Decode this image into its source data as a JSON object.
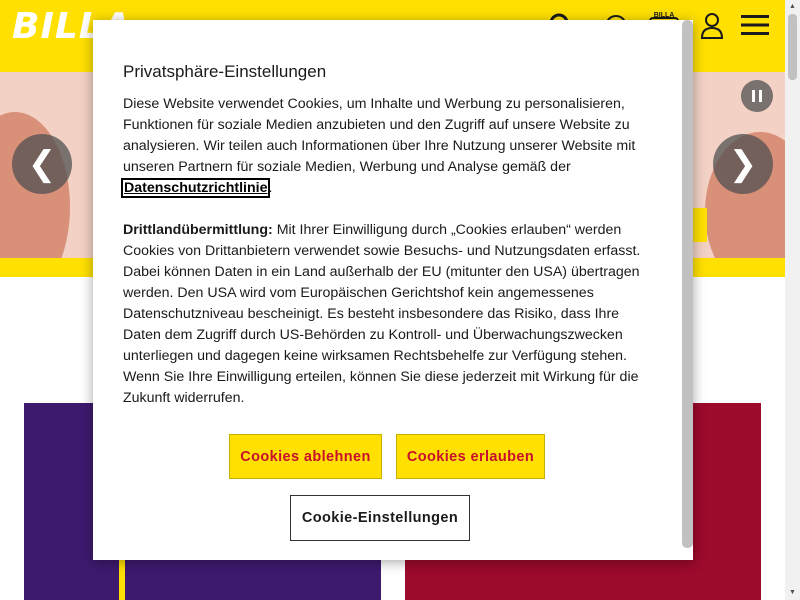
{
  "header": {
    "logo": "BILLA",
    "club_badge": "BILLA"
  },
  "hero": {
    "prev_symbol": "❮",
    "next_symbol": "❯"
  },
  "cookie_dialog": {
    "title": "Privatsphäre-Einstellungen",
    "intro_text": "Diese Website verwendet Cookies, um Inhalte und Werbung zu personalisieren, Funktionen für soziale Medien anzubieten und den Zugriff auf unsere Website zu analysieren. Wir teilen auch Informationen über Ihre Nutzung unserer Website mit unseren Partnern für soziale Medien, Werbung und Analyse gemäß der",
    "policy_link": "Datenschutzrichtlinie",
    "intro_end": ".",
    "third_country_label": "Drittlandübermittlung:",
    "third_country_text": " Mit Ihrer Einwilligung durch „Cookies erlauben“ werden Cookies von Drittanbietern verwendet sowie Besuchs- und Nutzungsdaten erfasst. Dabei können Daten in ein Land außerhalb der EU (mitunter den USA) übertragen werden. Den USA wird vom Europäischen Gerichtshof kein angemessenes Datenschutzniveau bescheinigt. Es besteht insbesondere das Risiko, dass Ihre Daten dem Zugriff durch US-Behörden zu Kontroll- und Überwachungszwecken unterliegen und dagegen keine wirksamen Rechtsbehelfe zur Verfügung stehen. Wenn Sie Ihre Einwilligung erteilen, können Sie diese jederzeit mit Wirkung für die Zukunft widerrufen.",
    "decline_label": "Cookies ablehnen",
    "accept_label": "Cookies erlauben",
    "settings_label": "Cookie-Einstellungen"
  },
  "colors": {
    "brand_yellow": "#ffe000",
    "brand_red": "#c8102e",
    "purple_tile": "#3d1a6e",
    "red_tile": "#9c0a2c"
  }
}
